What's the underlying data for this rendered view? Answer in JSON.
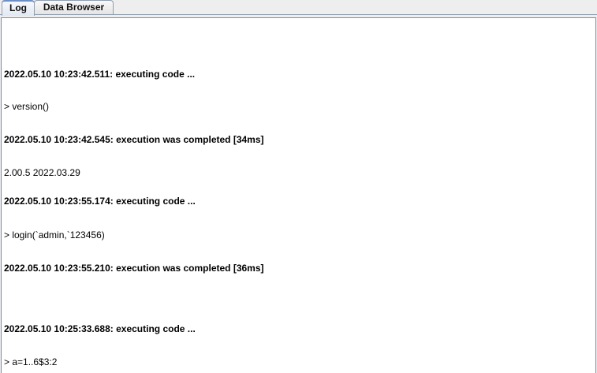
{
  "tabs": [
    {
      "label": "Log"
    },
    {
      "label": "Data Browser"
    }
  ],
  "log": {
    "lines": [
      {
        "type": "status",
        "text": "2022.05.10 10:23:42.511: executing code ..."
      },
      {
        "type": "code",
        "text": "> version()"
      },
      {
        "type": "status",
        "text": "2022.05.10 10:23:42.545: execution was completed [34ms]"
      },
      {
        "type": "output",
        "text": "2.00.5 2022.03.29"
      },
      {
        "type": "status",
        "text": "2022.05.10 10:23:55.174: executing code ..."
      },
      {
        "type": "code",
        "text": "> login(`admin,`123456)"
      },
      {
        "type": "status",
        "text": "2022.05.10 10:23:55.210: execution was completed [36ms]"
      },
      {
        "type": "status",
        "text": "2022.05.10 10:25:33.688: executing code ..."
      },
      {
        "type": "code",
        "text": "> a=1..6$3:2"
      }
    ]
  }
}
